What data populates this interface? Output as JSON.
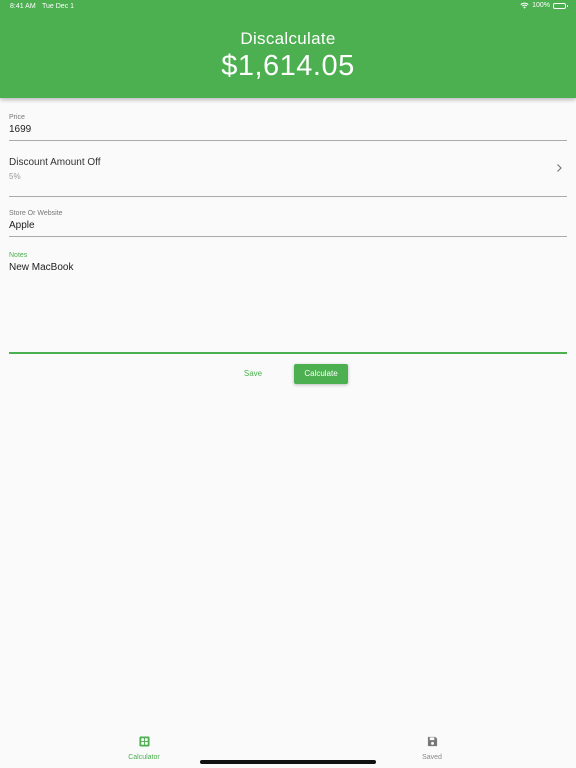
{
  "status_bar": {
    "time": "8:41 AM",
    "date": "Tue Dec 1",
    "battery": "100%"
  },
  "header": {
    "title": "Discalculate",
    "amount": "$1,614.05"
  },
  "form": {
    "price": {
      "label": "Price",
      "value": "1699"
    },
    "discount": {
      "title": "Discount Amount Off",
      "value": "5%"
    },
    "store": {
      "label": "Store Or Website",
      "value": "Apple"
    },
    "notes": {
      "label": "Notes",
      "value": "New MacBook"
    }
  },
  "actions": {
    "save_label": "Save",
    "calculate_label": "Calculate"
  },
  "tabs": [
    {
      "label": "Calculator",
      "icon": "calculator-icon",
      "active": true
    },
    {
      "label": "Saved",
      "icon": "save-icon",
      "active": false
    }
  ],
  "colors": {
    "accent": "#4caf50",
    "background": "#fafafa",
    "inactive_tab": "#888888"
  }
}
